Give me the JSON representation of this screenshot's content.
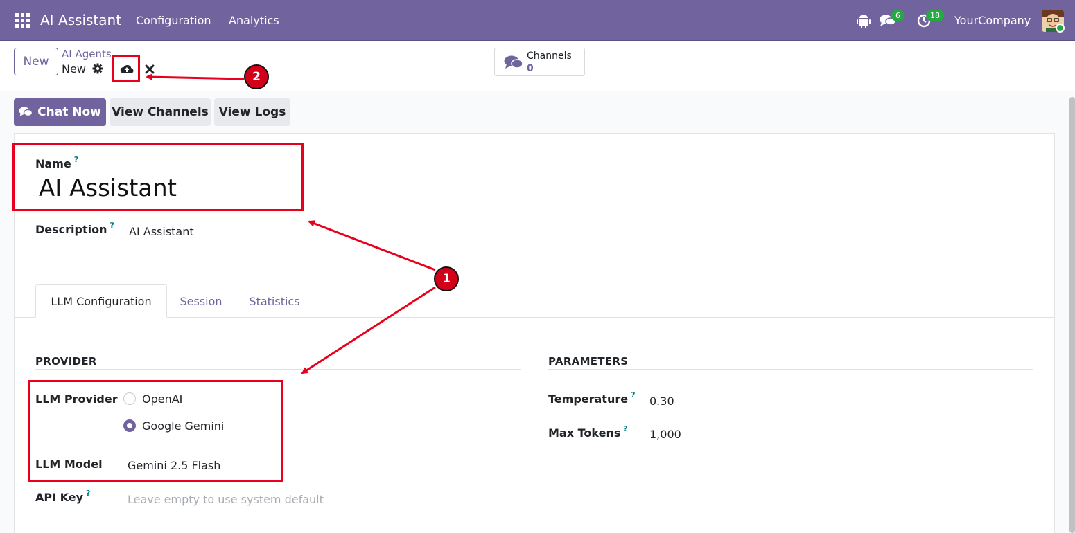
{
  "navbar": {
    "app_title": "AI Assistant",
    "menu": [
      "Configuration",
      "Analytics"
    ],
    "messages_count": "6",
    "activities_count": "18",
    "company": "YourCompany"
  },
  "control": {
    "new_label": "New",
    "breadcrumb_parent": "AI Agents",
    "breadcrumb_current": "New",
    "stat_label": "Channels",
    "stat_value": "0"
  },
  "actions": {
    "chat_now": "Chat Now",
    "view_channels": "View Channels",
    "view_logs": "View Logs"
  },
  "form": {
    "name_label": "Name",
    "name_value": "AI Assistant",
    "description_label": "Description",
    "description_value": "AI Assistant",
    "help_mark": "?",
    "tabs": [
      "LLM Configuration",
      "Session",
      "Statistics"
    ],
    "provider_section": "PROVIDER",
    "parameters_section": "PARAMETERS",
    "llm_provider_label": "LLM Provider",
    "provider_options": [
      "OpenAI",
      "Google Gemini"
    ],
    "provider_selected": "Google Gemini",
    "llm_model_label": "LLM Model",
    "llm_model_value": "Gemini 2.5 Flash",
    "api_key_label": "API Key",
    "api_key_placeholder": "Leave empty to use system default",
    "temperature_label": "Temperature",
    "temperature_value": "0.30",
    "max_tokens_label": "Max Tokens",
    "max_tokens_value": "1,000"
  },
  "annotations": {
    "callout_1": "1",
    "callout_2": "2"
  },
  "colors": {
    "brand": "#71639e",
    "annotation_red": "#e8001c",
    "badge_green": "#28a745"
  }
}
